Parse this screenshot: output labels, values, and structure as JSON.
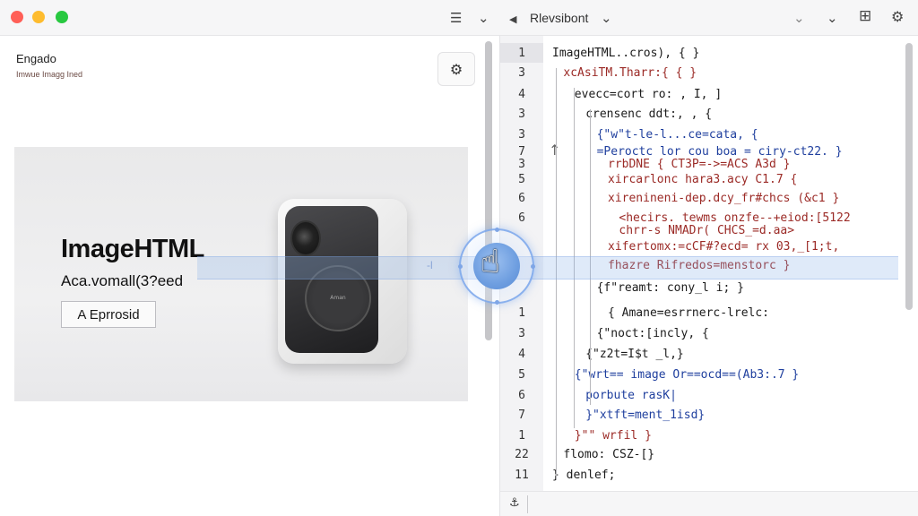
{
  "titlebar": {
    "left_icon_list": "☰",
    "left_icon_chevron": "⌄",
    "back_arrow": "◀",
    "title": "Rlevsibont",
    "title_chevron": "⌄",
    "right_chevron_1": "⌄",
    "right_chevron_2": "⌄",
    "layout_icon": "⊞",
    "settings_icon": "⚙"
  },
  "left_pane": {
    "title": "Engado",
    "subtitle": "Imwue Imagg Ined",
    "tool_icon": "⚙",
    "hero": {
      "title": "ImageHTML",
      "subtitle": "Aca.vomall(3?eed",
      "button_label": "A Eprrosid",
      "device_label": "Aman"
    }
  },
  "editor": {
    "footer_icon": "⚓",
    "up_arrow": "↑",
    "highlight_mark": "-l",
    "lines": [
      {
        "n": "1",
        "text": "ImageHTML..cros), { }",
        "indent": 0,
        "color": "dark"
      },
      {
        "n": "3",
        "text": "xcAsiTM.Tharr:{ { }",
        "indent": 1,
        "color": "red"
      },
      {
        "n": "4",
        "text": "evecc=cort ro: , I, ]",
        "indent": 2,
        "color": "dark"
      },
      {
        "n": "3",
        "text": "crensenc ddt:, , {",
        "indent": 3,
        "color": "dark"
      },
      {
        "n": "3",
        "text": "{\"w\"t-le-l...ce=cata, {",
        "indent": 4,
        "color": "blue"
      },
      {
        "n": "7",
        "text": "=Peroctc lor cou boa = ciry-ct22. }",
        "indent": 4,
        "color": "blue"
      },
      {
        "n": "3",
        "text": "rrbDNE { CT3P=->=ACS A3d }",
        "indent": 5,
        "color": "red"
      },
      {
        "n": "5",
        "text": "xircarlonc hara3.acy C1.7 {",
        "indent": 5,
        "color": "red"
      },
      {
        "n": "6",
        "text": "xirenineni-dep.dcy_fr#chcs (&c1 }",
        "indent": 5,
        "color": "red"
      },
      {
        "n": "6",
        "text": "<hecirs. tewms onzfe--+eiod:[5122",
        "indent": 6,
        "color": "red"
      },
      {
        "n": "",
        "text": "chrr-s NMADr( CHCS_=d.aa>",
        "indent": 6,
        "color": "red"
      },
      {
        "n": "",
        "text": "xifertomx:=cCF#?ecd= rx 03,_[1;t,",
        "indent": 5,
        "color": "red"
      },
      {
        "n": "",
        "text": "fhazre Rifredos=menstorc }",
        "indent": 5,
        "color": "red"
      },
      {
        "n": "",
        "text": "{f\"reamt: cony_l i; }",
        "indent": 4,
        "color": "dark"
      },
      {
        "n": "1",
        "text": "{ Amane=esrrnerc-lrelc:",
        "indent": 5,
        "color": "dark"
      },
      {
        "n": "3",
        "text": "{\"noct:[incly, {",
        "indent": 4,
        "color": "dark"
      },
      {
        "n": "4",
        "text": "{\"z2t=I$t _l,}",
        "indent": 3,
        "color": "dark"
      },
      {
        "n": "5",
        "text": "{\"wrt== image Or==ocd==(Ab3:.7 }",
        "indent": 2,
        "color": "blue"
      },
      {
        "n": "6",
        "text": "porbute rasK|",
        "indent": 3,
        "color": "blue"
      },
      {
        "n": "7",
        "text": "}\"xtft=ment_1isd}",
        "indent": 3,
        "color": "blue"
      },
      {
        "n": "1",
        "text": "}\"\" wrfil }",
        "indent": 2,
        "color": "red"
      },
      {
        "n": "22",
        "text": "flomo: CSZ-[}",
        "indent": 1,
        "color": "dark"
      },
      {
        "n": "11",
        "text": "} denlef;",
        "indent": 0,
        "color": "dark"
      }
    ]
  },
  "colors": {
    "accent": "#6e9ee0",
    "highlight": "#8cb4eb",
    "code_blue": "#1f3f9e",
    "code_red": "#9b2a26"
  }
}
